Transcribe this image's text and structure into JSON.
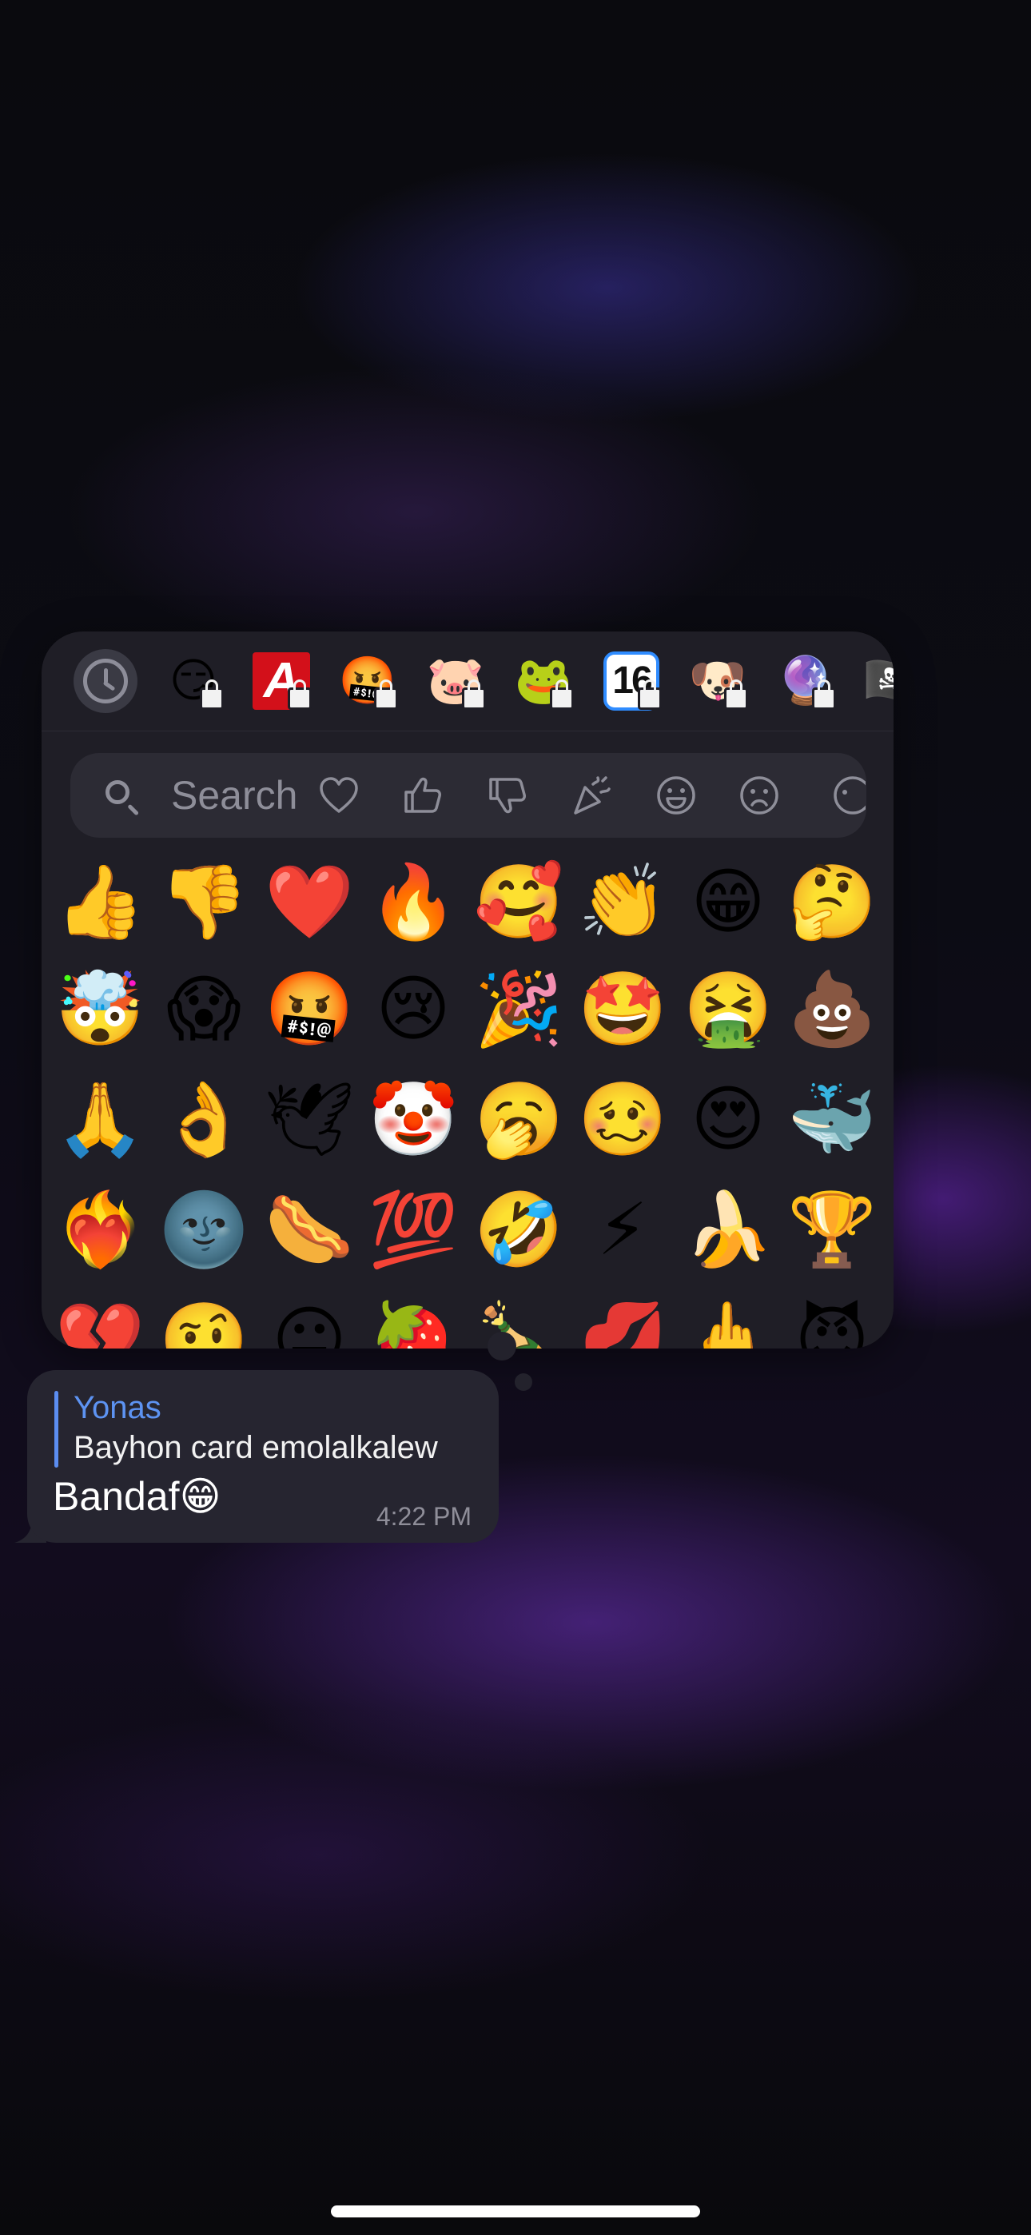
{
  "picker": {
    "packs": [
      {
        "name": "recent-icon",
        "glyph": "",
        "locked": false,
        "kind": "clock"
      },
      {
        "name": "pack-face-icon",
        "glyph": "😏",
        "locked": true
      },
      {
        "name": "pack-letter-a-icon",
        "glyph": "A",
        "locked": true,
        "kind": "letter-a"
      },
      {
        "name": "pack-fire-face-icon",
        "glyph": "🤬",
        "locked": true
      },
      {
        "name": "pack-pink-bear-icon",
        "glyph": "🐷",
        "locked": true
      },
      {
        "name": "pack-pepe-frog-icon",
        "glyph": "🐸",
        "locked": true
      },
      {
        "name": "pack-number-16-icon",
        "glyph": "16",
        "locked": true,
        "kind": "number"
      },
      {
        "name": "pack-doge-icon",
        "glyph": "🐶",
        "locked": true
      },
      {
        "name": "pack-purple-badge-icon",
        "glyph": "🔮",
        "locked": true
      },
      {
        "name": "pack-pirate-flag-icon",
        "glyph": "🏴‍☠️",
        "locked": true
      }
    ],
    "search": {
      "label": "Search",
      "categories": [
        {
          "name": "heart-category-icon",
          "icon": "heart"
        },
        {
          "name": "thumbs-up-category-icon",
          "icon": "thumbs-up"
        },
        {
          "name": "thumbs-down-category-icon",
          "icon": "thumbs-down"
        },
        {
          "name": "party-category-icon",
          "icon": "party"
        },
        {
          "name": "smile-category-icon",
          "icon": "smile"
        },
        {
          "name": "sad-category-icon",
          "icon": "sad"
        },
        {
          "name": "more-faces-category-icon",
          "icon": "face-partial"
        }
      ]
    },
    "emoji_rows": [
      [
        "👍",
        "👎",
        "❤️",
        "🔥",
        "🥰",
        "👏",
        "😁",
        "🤔"
      ],
      [
        "🤯",
        "😱",
        "🤬",
        "😢",
        "🎉",
        "🤩",
        "🤮",
        "💩"
      ],
      [
        "🙏",
        "👌",
        "🕊",
        "🤡",
        "🥱",
        "🥴",
        "😍",
        "🐳"
      ],
      [
        "❤️‍🔥",
        "🌚",
        "🌭",
        "💯",
        "🤣",
        "⚡",
        "🍌",
        "🏆"
      ],
      [
        "💔",
        "🤨",
        "😐",
        "🍓",
        "🍾",
        "💋",
        "🖕",
        "😈"
      ]
    ]
  },
  "message": {
    "reply_author": "Yonas",
    "reply_text": "Bayhon card emolalkalew",
    "text": "Bandaf😁",
    "time": "4:22 PM"
  }
}
